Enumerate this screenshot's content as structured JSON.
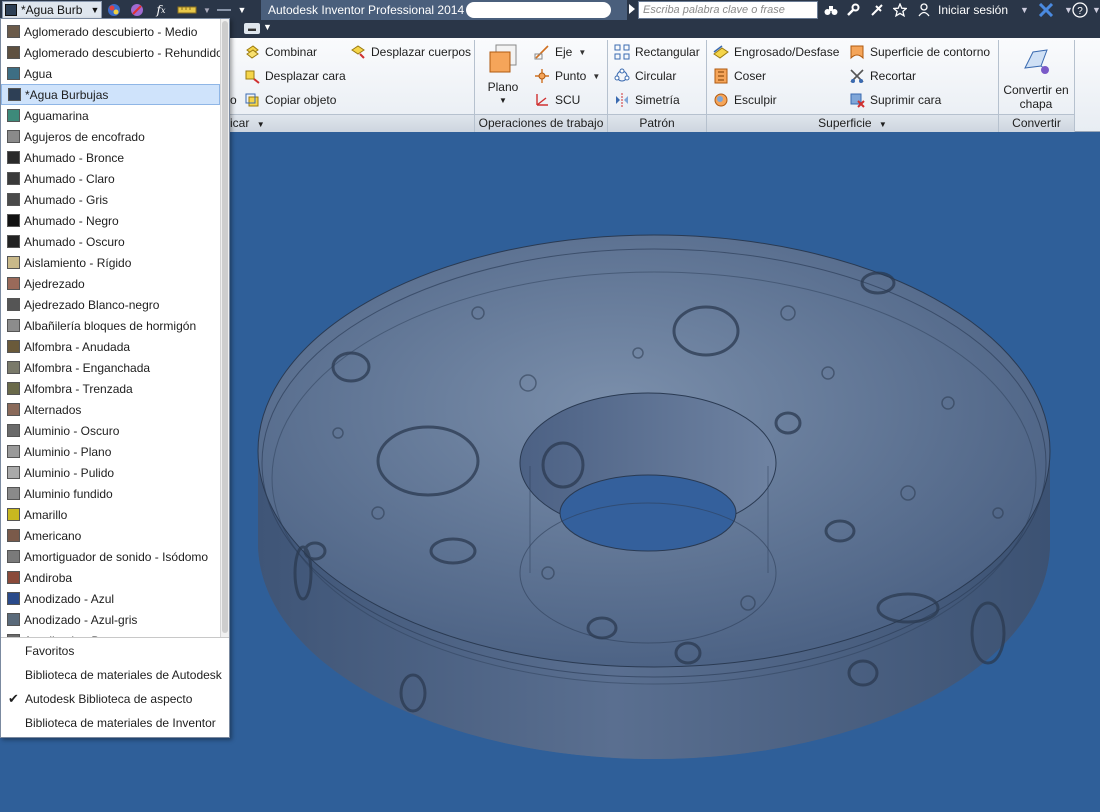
{
  "titlebar": {
    "appearance_value": "*Agua Burb",
    "app_title": "Autodesk Inventor Professional 2014",
    "search_placeholder": "Escriba palabra clave o frase",
    "signin_label": "Iniciar sesión"
  },
  "ribbon": {
    "modify_partial": {
      "footer": "icar",
      "partial_button": "o",
      "buttons": [
        {
          "label": "Combinar",
          "icon": "combine-icon"
        },
        {
          "label": "Desplazar cara",
          "icon": "move-face-icon"
        },
        {
          "label": "Copiar objeto",
          "icon": "copy-object-icon"
        },
        {
          "label": "Desplazar cuerpos",
          "icon": "move-bodies-icon"
        }
      ]
    },
    "work_features": {
      "footer": "Operaciones de trabajo",
      "plane_label": "Plano",
      "buttons": [
        {
          "label": "Eje",
          "icon": "axis-icon"
        },
        {
          "label": "Punto",
          "icon": "point-icon"
        },
        {
          "label": "SCU",
          "icon": "ucs-icon"
        }
      ]
    },
    "pattern": {
      "footer": "Patrón",
      "buttons": [
        {
          "label": "Rectangular",
          "icon": "rectangular-pattern-icon"
        },
        {
          "label": "Circular",
          "icon": "circular-pattern-icon"
        },
        {
          "label": "Simetría",
          "icon": "mirror-icon"
        }
      ]
    },
    "surface": {
      "footer": "Superficie",
      "buttons": [
        {
          "label": "Engrosado/Desfase",
          "icon": "thicken-icon"
        },
        {
          "label": "Coser",
          "icon": "stitch-icon"
        },
        {
          "label": "Esculpir",
          "icon": "sculpt-icon"
        },
        {
          "label": "Superficie de contorno",
          "icon": "boundary-patch-icon"
        },
        {
          "label": "Recortar",
          "icon": "trim-icon"
        },
        {
          "label": "Suprimir cara",
          "icon": "delete-face-icon"
        }
      ]
    },
    "convert": {
      "footer": "Convertir",
      "button_line1": "Convertir en",
      "button_line2": "chapa"
    }
  },
  "material_dropdown": {
    "items": [
      {
        "label": "Aglomerado descubierto - Medio",
        "color": "#6b5b4a"
      },
      {
        "label": "Aglomerado descubierto - Rehundido",
        "color": "#5e5040"
      },
      {
        "label": "Agua",
        "color": "#3d6e84"
      },
      {
        "label": "*Agua Burbujas",
        "color": "#2d3f55",
        "selected": true
      },
      {
        "label": "Aguamarina",
        "color": "#3d8a7a"
      },
      {
        "label": "Agujeros de encofrado",
        "color": "#8a8a8a"
      },
      {
        "label": "Ahumado - Bronce",
        "color": "#2a2a2a"
      },
      {
        "label": "Ahumado - Claro",
        "color": "#3a3a3a"
      },
      {
        "label": "Ahumado - Gris",
        "color": "#4a4a4a"
      },
      {
        "label": "Ahumado - Negro",
        "color": "#111111"
      },
      {
        "label": "Ahumado - Oscuro",
        "color": "#222222"
      },
      {
        "label": "Aislamiento - Rígido",
        "color": "#c9b98a"
      },
      {
        "label": "Ajedrezado",
        "color": "#9a6a5a"
      },
      {
        "label": "Ajedrezado Blanco-negro",
        "color": "#555555"
      },
      {
        "label": "Albañilería bloques de hormigón",
        "color": "#8c8c8c"
      },
      {
        "label": "Alfombra - Anudada",
        "color": "#6a5a3a"
      },
      {
        "label": "Alfombra - Enganchada",
        "color": "#7a7a6a"
      },
      {
        "label": "Alfombra - Trenzada",
        "color": "#6a6a4a"
      },
      {
        "label": "Alternados",
        "color": "#8a6a5a"
      },
      {
        "label": "Aluminio - Oscuro",
        "color": "#6a6a6a"
      },
      {
        "label": "Aluminio - Plano",
        "color": "#9a9a9a"
      },
      {
        "label": "Aluminio - Pulido",
        "color": "#aaaaaa"
      },
      {
        "label": "Aluminio fundido",
        "color": "#8a8a8a"
      },
      {
        "label": "Amarillo",
        "color": "#c8b820"
      },
      {
        "label": "Americano",
        "color": "#7a5a4a"
      },
      {
        "label": "Amortiguador de sonido - Isódomo",
        "color": "#7a7a7a"
      },
      {
        "label": "Andiroba",
        "color": "#8a4a3a"
      },
      {
        "label": "Anodizado - Azul",
        "color": "#2a4a8a"
      },
      {
        "label": "Anodizado - Azul-gris",
        "color": "#5a6a7a"
      },
      {
        "label": "Anodizado - Bronce",
        "color": "#6a6a6a"
      }
    ],
    "libraries": [
      {
        "label": "Favoritos",
        "checked": false
      },
      {
        "label": "Biblioteca de materiales de Autodesk",
        "checked": false
      },
      {
        "label": "Autodesk Biblioteca de aspecto",
        "checked": true
      },
      {
        "label": "Biblioteca de materiales de Inventor",
        "checked": false
      }
    ]
  },
  "colors": {
    "viewport_background": "#2f5f99",
    "part_color": "#5d7394",
    "titlebar": "#2a3648"
  }
}
